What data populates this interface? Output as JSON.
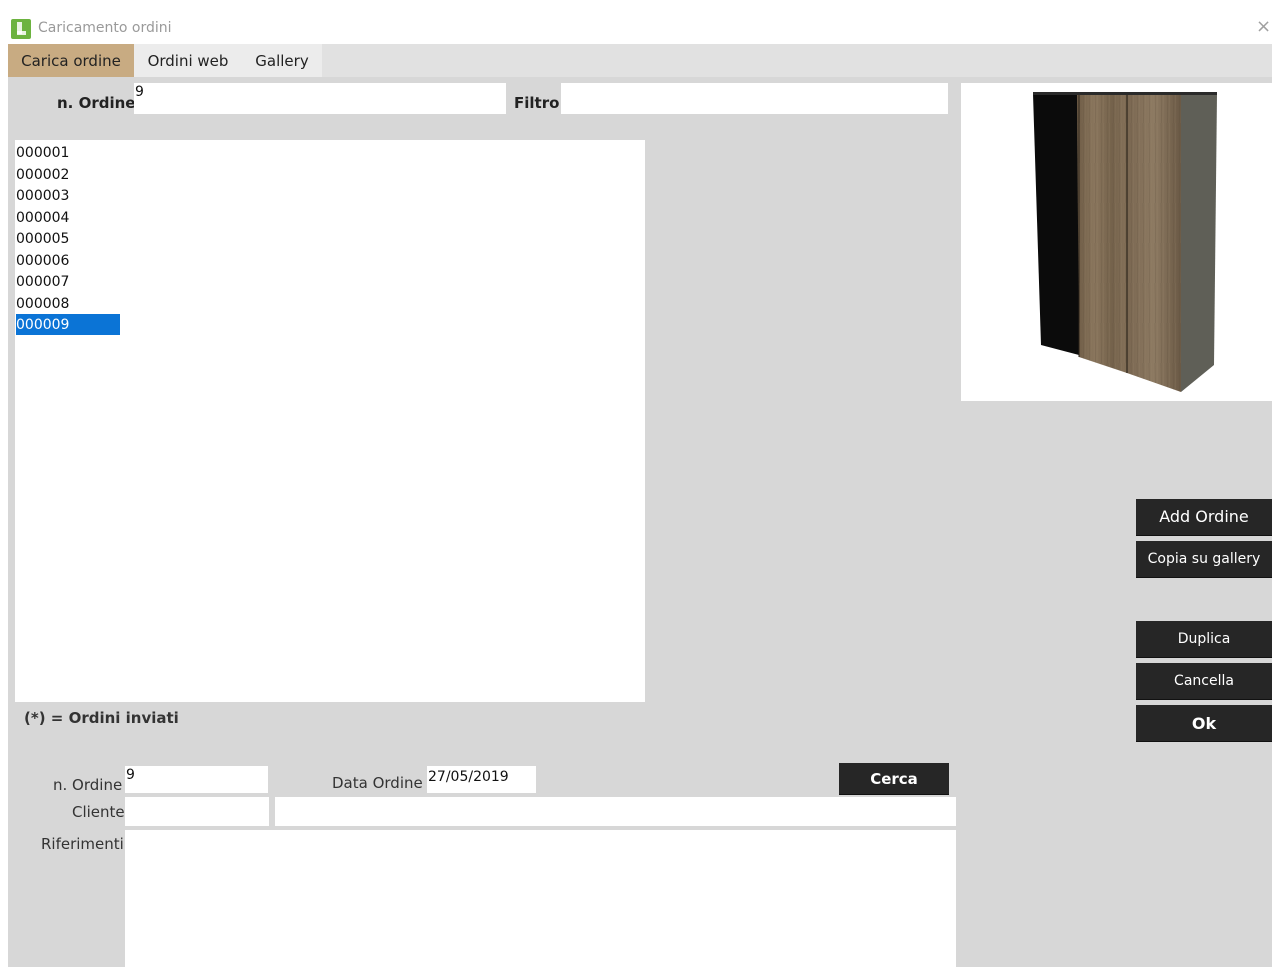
{
  "window": {
    "title": "Caricamento ordini",
    "close_glyph": "×"
  },
  "tabs": [
    {
      "label": "Carica ordine",
      "active": true
    },
    {
      "label": "Ordini web",
      "active": false
    },
    {
      "label": "Gallery",
      "active": false
    }
  ],
  "search": {
    "order_label": "n. Ordine",
    "order_value": "9",
    "filter_label": "Filtro",
    "filter_value": ""
  },
  "orders": {
    "items": [
      "000001",
      "000002",
      "000003",
      "000004",
      "000005",
      "000006",
      "000007",
      "000008",
      "000009"
    ],
    "selected": "000009",
    "legend": "(*) = Ordini inviati"
  },
  "preview": {
    "image": "wardrobe-3d-render",
    "colors": {
      "wood": "#7d6a52",
      "dark": "#0d0d0d",
      "side": "#5d5d56"
    }
  },
  "actions": {
    "add_order": "Add Ordine",
    "copy_gallery": "Copia su gallery",
    "duplicate": "Duplica",
    "delete": "Cancella",
    "ok": "Ok"
  },
  "details": {
    "order_label": "n. Ordine",
    "order_value": "9",
    "date_label": "Data Ordine",
    "date_value": "27/05/2019",
    "search_button": "Cerca",
    "client_label": "Cliente",
    "client_code": "",
    "client_name": "",
    "references_label": "Riferimenti",
    "references_value": ""
  },
  "colors": {
    "panel": "#d7d7d7",
    "active_tab": "#c8ab82",
    "selection": "#0b74d6",
    "button": "#262626"
  }
}
